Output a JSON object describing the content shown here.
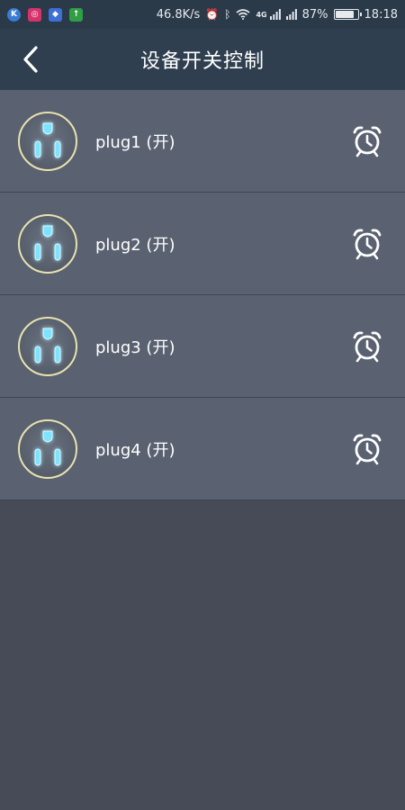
{
  "status_bar": {
    "app_icons": [
      {
        "name": "k-app-icon",
        "glyph": "K",
        "color": "#3a7bd5"
      },
      {
        "name": "refresh-app-icon",
        "glyph": "◎",
        "color": "#d6336c"
      },
      {
        "name": "shield-app-icon",
        "glyph": "◆",
        "color": "#3d6fd6"
      },
      {
        "name": "upload-app-icon",
        "glyph": "↑",
        "color": "#2f9e44"
      }
    ],
    "net_speed": "46.8K/s",
    "network_label": "4G",
    "battery_text": "87%",
    "battery_level": 0.87,
    "time": "18:18"
  },
  "header": {
    "title": "设备开关控制",
    "back_icon": "chevron-left-icon"
  },
  "devices": [
    {
      "label": "plug1 (开)",
      "icon": "socket-icon",
      "action_icon": "alarm-clock-icon"
    },
    {
      "label": "plug2 (开)",
      "icon": "socket-icon",
      "action_icon": "alarm-clock-icon"
    },
    {
      "label": "plug3 (开)",
      "icon": "socket-icon",
      "action_icon": "alarm-clock-icon"
    },
    {
      "label": "plug4 (开)",
      "icon": "socket-icon",
      "action_icon": "alarm-clock-icon"
    }
  ],
  "colors": {
    "status_bar_bg": "#2b3a49",
    "title_bar_bg": "#2f3f4f",
    "row_bg": "#5a6271",
    "page_bg": "#464b57",
    "socket_accent": "#7fe3ff",
    "socket_ring": "#e8e2b0"
  }
}
